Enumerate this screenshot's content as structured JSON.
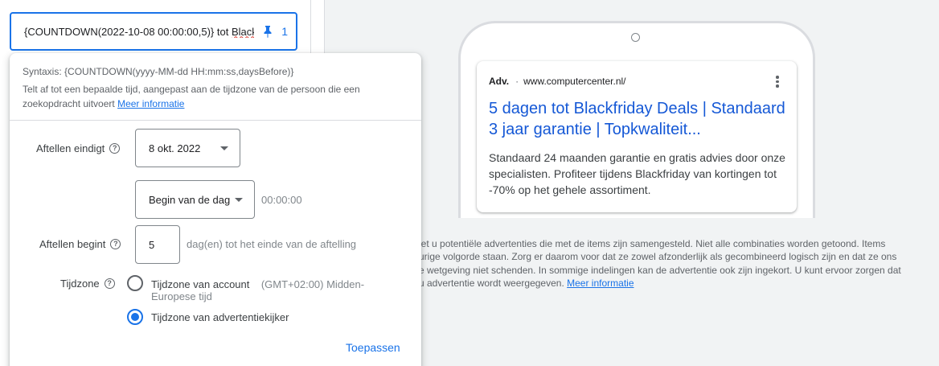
{
  "headline": {
    "text_before": "{COUNTDOWN(2022-10-08 00:00:00,5)} tot ",
    "text_misspelled": "Blackf",
    "pin_count": "1"
  },
  "popup": {
    "syntax": "Syntaxis: {COUNTDOWN(yyyy-MM-dd HH:mm:ss,daysBefore)}",
    "description": "Telt af tot een bepaalde tijd, aangepast aan de tijdzone van de persoon die een zoekopdracht uitvoert",
    "more_info": "Meer informatie",
    "countdown_ends_label": "Aftellen eindigt",
    "date_value": "8 okt. 2022",
    "time_of_day_value": "Begin van de dag",
    "time_text": "00:00:00",
    "countdown_starts_label": "Aftellen begint",
    "days_value": "5",
    "days_suffix": "dag(en) tot het einde van de aftelling",
    "timezone_label": "Tijdzone",
    "tz_account_label": "Tijdzone van account",
    "tz_account_sub": "(GMT+02:00) Midden-Europese tijd",
    "tz_viewer_label": "Tijdzone van advertentiekijker",
    "tz_selected": "viewer",
    "apply": "Toepassen"
  },
  "preview": {
    "ad_badge": "Adv.",
    "ad_url": "www.computercenter.nl/",
    "ad_title": "5 dagen tot Blackfriday Deals | Standaard 3 jaar garantie | Topkwaliteit...",
    "ad_description": "Standaard 24 maanden garantie en gratis advies door onze specialisten. Profiteer tijdens Blackfriday van kortingen tot -70% op het gehele assortiment."
  },
  "note": {
    "line1": "iet u potentiële advertenties die met de items zijn samengesteld. Niet alle combinaties worden getoond. Items",
    "line2": "urige volgorde staan. Zorg er daarom voor dat ze zowel afzonderlijk als gecombineerd logisch zijn en dat ze ons",
    "line3": "e wetgeving niet schenden. In sommige indelingen kan de advertentie ook zijn ingekort. U kunt ervoor zorgen dat",
    "line4": "u advertentie wordt weergegeven.",
    "more_info": "Meer informatie"
  },
  "colors": {
    "accent": "#1a73e8",
    "ad_title": "#1558d6",
    "error": "#d93025"
  },
  "icons": [
    "pin-icon",
    "help-icon",
    "chevron-down-icon",
    "kebab-menu-icon",
    "camera-icon"
  ]
}
